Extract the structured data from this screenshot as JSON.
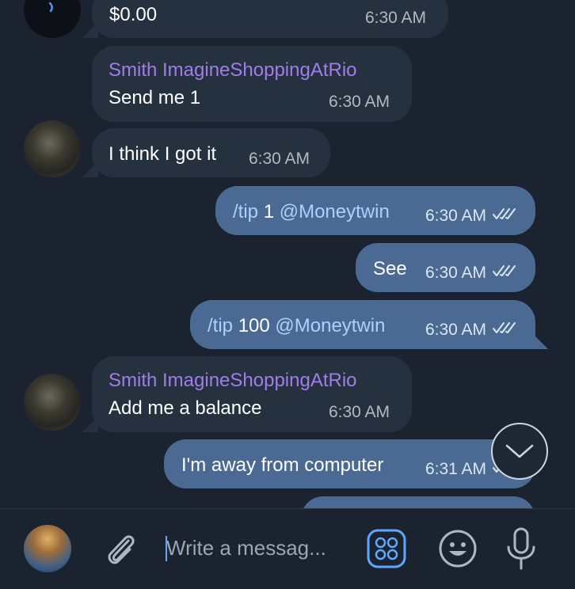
{
  "messages": [
    {
      "text": "$0.00",
      "time": "6:30 AM"
    },
    {
      "sender": "Smith ImagineShoppingAtRio",
      "text": "Send me 1",
      "time": "6:30 AM"
    },
    {
      "text": "I think I got it",
      "time": "6:30 AM"
    },
    {
      "cmd": "/tip",
      "amount": "1",
      "mention": "@Moneytwin",
      "time": "6:30 AM"
    },
    {
      "text": "See",
      "time": "6:30 AM"
    },
    {
      "cmd": "/tip",
      "amount": "100",
      "mention": "@Moneytwin",
      "time": "6:30 AM"
    },
    {
      "sender": "Smith ImagineShoppingAtRio",
      "text": "Add me a balance",
      "time": "6:30 AM"
    },
    {
      "text": "I'm away from computer",
      "time": "6:31 AM"
    }
  ],
  "composer": {
    "placeholder": "Write a messag..."
  },
  "colors": {
    "background": "#1b2330",
    "incoming_bubble": "#263140",
    "outgoing_bubble": "#4a6a93",
    "sender_name": "#a17de8",
    "link": "#a9d2ff",
    "accent": "#5ea8ff"
  },
  "icons": {
    "attach": "paperclip-icon",
    "bot_commands": "bot-commands-icon",
    "emoji": "emoji-icon",
    "voice": "microphone-icon",
    "scroll_down": "chevron-down-icon"
  }
}
